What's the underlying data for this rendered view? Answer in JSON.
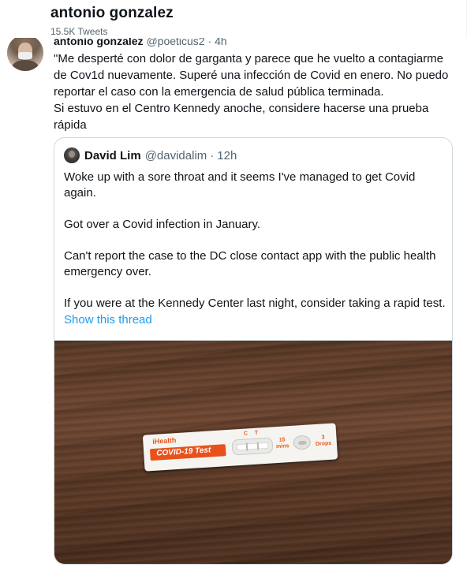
{
  "profile_header": {
    "name": "antonio gonzalez",
    "tweet_count": "15.5K Tweets"
  },
  "tweet": {
    "author_name": "antonio gonzalez",
    "author_handle": "@poeticus2",
    "separator": "·",
    "time": "4h",
    "text_lines": [
      "\"Me desperté con dolor de garganta y parece que he vuelto a contagiarme",
      "de Cov1d nuevamente. Superé una infección de Covid en enero. No puedo",
      "reportar el caso con la emergencia de salud pública terminada.",
      "Si estuvo en el Centro Kennedy anoche, considere hacerse una prueba",
      "rápida"
    ]
  },
  "quote": {
    "author_name": "David Lim",
    "author_handle": "@davidalim",
    "separator": "·",
    "time": "12h",
    "paragraphs": [
      "Woke up with a sore throat and it seems I've managed to get Covid again.",
      "Got over a Covid infection in January.",
      "Can't report the case to the DC close contact app with the public health emergency over.",
      "If you were at the Kennedy Center last night, consider taking a rapid test."
    ],
    "show_thread_label": "Show this thread"
  },
  "photo": {
    "kit_brand": "iHealth",
    "kit_name": "COVID-19 Test",
    "label_c": "C",
    "label_t": "T",
    "mins_value": "15",
    "mins_unit": "mins",
    "drops_value": "3",
    "drops_unit": "Drops"
  },
  "colors": {
    "link": "#1d9bf0",
    "secondary_text": "#536471",
    "kit_orange": "#e8521a"
  }
}
